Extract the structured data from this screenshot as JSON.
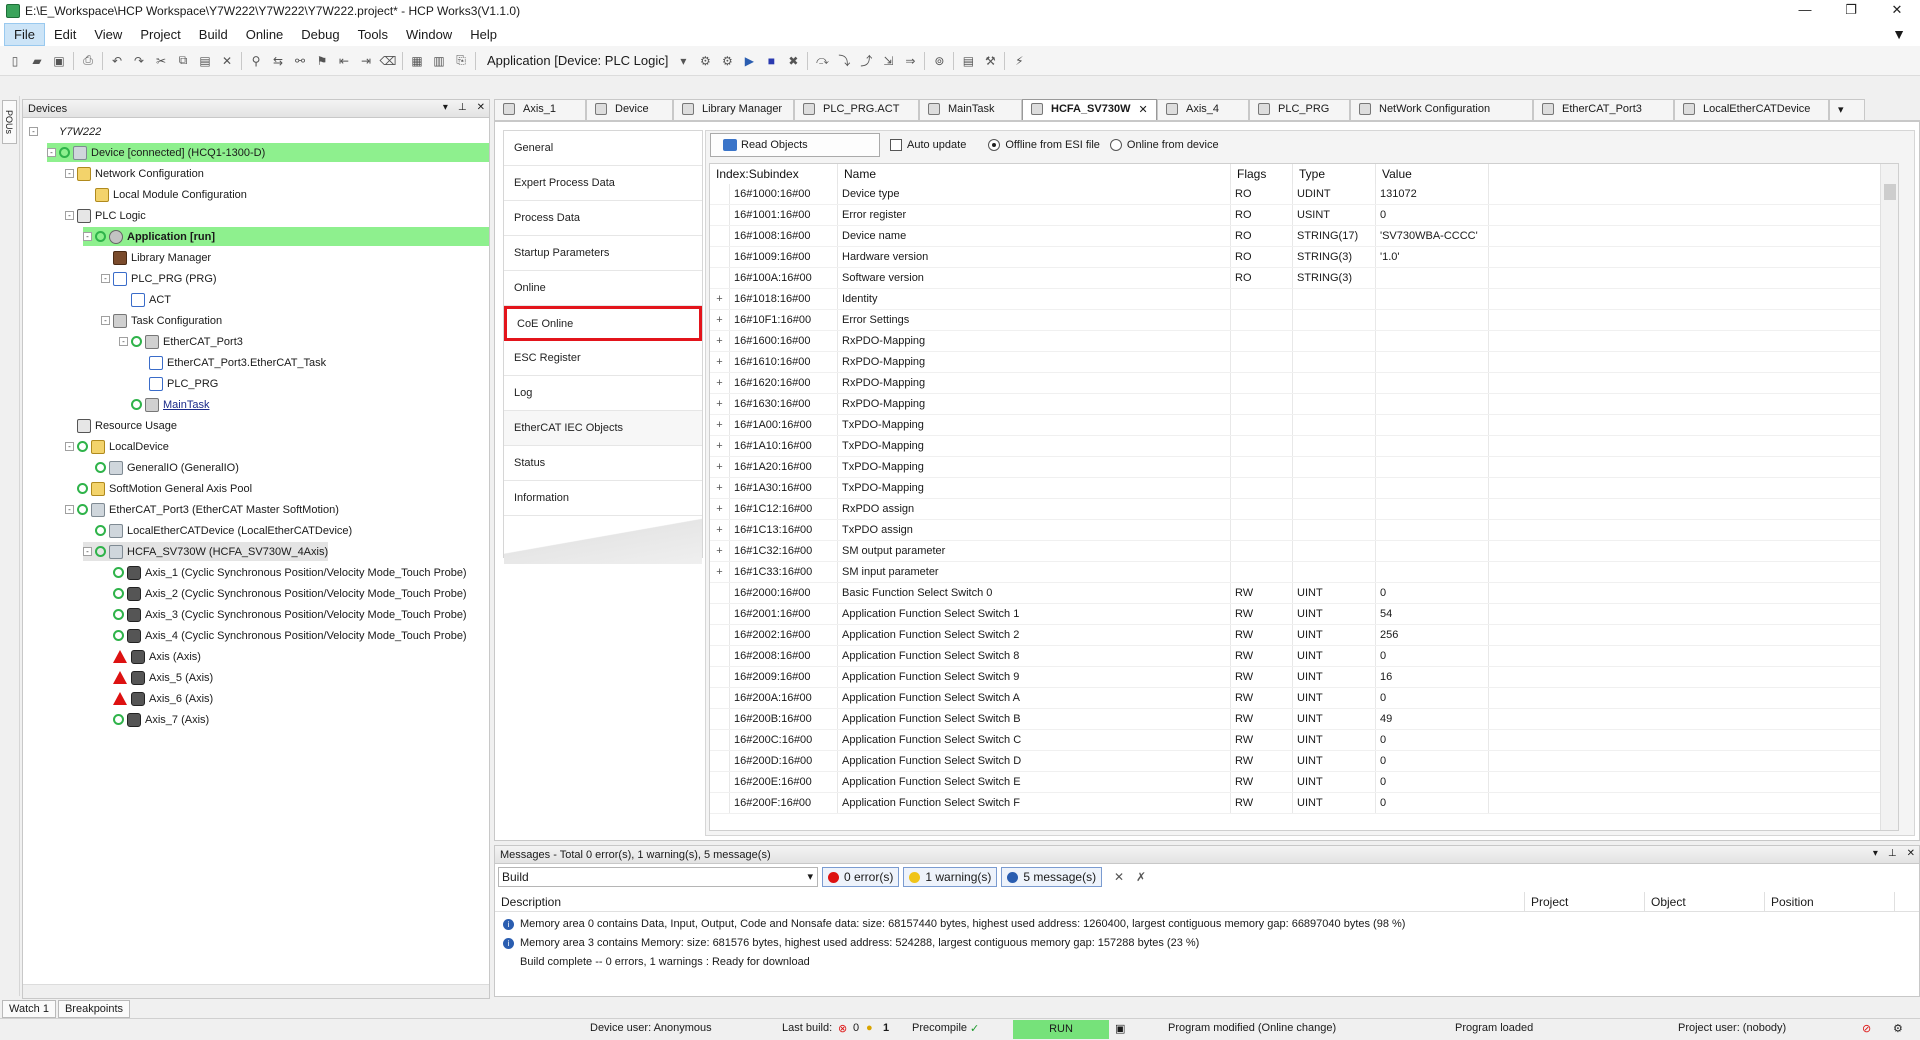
{
  "window": {
    "title": "E:\\E_Workspace\\HCP Workspace\\Y7W222\\Y7W222\\Y7W222.project* - HCP Works3(V1.1.0)"
  },
  "menu": [
    "File",
    "Edit",
    "View",
    "Project",
    "Build",
    "Online",
    "Debug",
    "Tools",
    "Window",
    "Help"
  ],
  "toolbar": {
    "application_selector": "Application [Device: PLC Logic]"
  },
  "left_strip": {
    "pous_tab": "POUs"
  },
  "devices": {
    "title": "Devices",
    "tree": [
      {
        "label": "Y7W222",
        "indent": 0,
        "exp": "-",
        "icon": "project",
        "italic": true
      },
      {
        "label": "Device [connected] (HCQ1-1300-D)",
        "indent": 1,
        "exp": "-",
        "icon": "dev",
        "green": true,
        "hl": true
      },
      {
        "label": "Network Configuration",
        "indent": 2,
        "exp": "-",
        "icon": "net"
      },
      {
        "label": "Local Module Configuration",
        "indent": 3,
        "exp": "",
        "icon": "net"
      },
      {
        "label": "PLC Logic",
        "indent": 2,
        "exp": "-",
        "icon": "plc"
      },
      {
        "label": "Application [run]",
        "indent": 3,
        "exp": "-",
        "icon": "app",
        "green": true,
        "hl": true,
        "bold": true
      },
      {
        "label": "Library Manager",
        "indent": 4,
        "exp": "",
        "icon": "lib"
      },
      {
        "label": "PLC_PRG (PRG)",
        "indent": 4,
        "exp": "-",
        "icon": "prg"
      },
      {
        "label": "ACT",
        "indent": 5,
        "exp": "",
        "icon": "prg"
      },
      {
        "label": "Task Configuration",
        "indent": 4,
        "exp": "-",
        "icon": "task"
      },
      {
        "label": "EtherCAT_Port3",
        "indent": 5,
        "exp": "-",
        "icon": "task",
        "green": true
      },
      {
        "label": "EtherCAT_Port3.EtherCAT_Task",
        "indent": 6,
        "exp": "",
        "icon": "prg"
      },
      {
        "label": "PLC_PRG",
        "indent": 6,
        "exp": "",
        "icon": "prg"
      },
      {
        "label": "MainTask",
        "indent": 5,
        "exp": "",
        "icon": "task",
        "green": true,
        "underline": true
      },
      {
        "label": "Resource Usage",
        "indent": 2,
        "exp": "",
        "icon": "plc"
      },
      {
        "label": "LocalDevice",
        "indent": 2,
        "exp": "-",
        "icon": "net",
        "green": true
      },
      {
        "label": "GeneralIO (GeneralIO)",
        "indent": 3,
        "exp": "",
        "icon": "dev",
        "green": true
      },
      {
        "label": "SoftMotion General Axis Pool",
        "indent": 2,
        "exp": "",
        "icon": "net",
        "green": true
      },
      {
        "label": "EtherCAT_Port3 (EtherCAT Master SoftMotion)",
        "indent": 2,
        "exp": "-",
        "icon": "dev",
        "green": true
      },
      {
        "label": "LocalEtherCATDevice (LocalEtherCATDevice)",
        "indent": 3,
        "exp": "",
        "icon": "dev",
        "green": true
      },
      {
        "label": "HCFA_SV730W (HCFA_SV730W_4Axis)",
        "indent": 3,
        "exp": "-",
        "icon": "dev",
        "green": true,
        "sel": true
      },
      {
        "label": "Axis_1 (Cyclic Synchronous Position/Velocity Mode_Touch Probe)",
        "indent": 4,
        "exp": "",
        "icon": "axis",
        "green": true
      },
      {
        "label": "Axis_2 (Cyclic Synchronous Position/Velocity Mode_Touch Probe)",
        "indent": 4,
        "exp": "",
        "icon": "axis",
        "green": true
      },
      {
        "label": "Axis_3 (Cyclic Synchronous Position/Velocity Mode_Touch Probe)",
        "indent": 4,
        "exp": "",
        "icon": "axis",
        "green": true
      },
      {
        "label": "Axis_4 (Cyclic Synchronous Position/Velocity Mode_Touch Probe)",
        "indent": 4,
        "exp": "",
        "icon": "axis",
        "green": true
      },
      {
        "label": "Axis (Axis)",
        "indent": 4,
        "exp": "",
        "icon": "axis",
        "warn": true
      },
      {
        "label": "Axis_5 (Axis)",
        "indent": 4,
        "exp": "",
        "icon": "axis",
        "warn": true
      },
      {
        "label": "Axis_6 (Axis)",
        "indent": 4,
        "exp": "",
        "icon": "axis",
        "warn": true
      },
      {
        "label": "Axis_7 (Axis)",
        "indent": 4,
        "exp": "",
        "icon": "axis",
        "green": true
      }
    ]
  },
  "bottom_tabs": [
    "Watch 1",
    "Breakpoints"
  ],
  "editor_tabs": [
    {
      "label": "Axis_1",
      "w": 92
    },
    {
      "label": "Device",
      "w": 87
    },
    {
      "label": "Library Manager",
      "w": 121
    },
    {
      "label": "PLC_PRG.ACT",
      "w": 125
    },
    {
      "label": "MainTask",
      "w": 103
    },
    {
      "label": "HCFA_SV730W",
      "w": 135,
      "active": true
    },
    {
      "label": "Axis_4",
      "w": 92
    },
    {
      "label": "PLC_PRG",
      "w": 101
    },
    {
      "label": "NetWork Configuration",
      "w": 183
    },
    {
      "label": "EtherCAT_Port3",
      "w": 141
    },
    {
      "label": "LocalEtherCATDevice",
      "w": 155
    }
  ],
  "side_nav": [
    {
      "label": "General"
    },
    {
      "label": "Expert Process Data"
    },
    {
      "label": "Process Data"
    },
    {
      "label": "Startup Parameters"
    },
    {
      "label": "Online"
    },
    {
      "label": "CoE Online",
      "selected": true
    },
    {
      "label": "ESC Register"
    },
    {
      "label": "Log"
    },
    {
      "label": "EtherCAT IEC Objects",
      "hover": true
    },
    {
      "label": "Status"
    },
    {
      "label": "Information"
    }
  ],
  "coe": {
    "read_button": "Read Objects",
    "auto_update": "Auto update",
    "offline_esi": "Offline from ESI file",
    "online_device": "Online from device",
    "columns": [
      "Index:Subindex",
      "Name",
      "Flags",
      "Type",
      "Value"
    ],
    "rows": [
      {
        "exp": "",
        "idx": "16#1000:16#00",
        "name": "Device type",
        "flags": "RO",
        "type": "UDINT",
        "value": "131072"
      },
      {
        "exp": "",
        "idx": "16#1001:16#00",
        "name": "Error register",
        "flags": "RO",
        "type": "USINT",
        "value": "0"
      },
      {
        "exp": "",
        "idx": "16#1008:16#00",
        "name": "Device name",
        "flags": "RO",
        "type": "STRING(17)",
        "value": "'SV730WBA-CCCC'"
      },
      {
        "exp": "",
        "idx": "16#1009:16#00",
        "name": "Hardware version",
        "flags": "RO",
        "type": "STRING(3)",
        "value": "'1.0'"
      },
      {
        "exp": "",
        "idx": "16#100A:16#00",
        "name": "Software version",
        "flags": "RO",
        "type": "STRING(3)",
        "value": ""
      },
      {
        "exp": "+",
        "idx": "16#1018:16#00",
        "name": "Identity",
        "flags": "",
        "type": "",
        "value": ""
      },
      {
        "exp": "+",
        "idx": "16#10F1:16#00",
        "name": "Error Settings",
        "flags": "",
        "type": "",
        "value": ""
      },
      {
        "exp": "+",
        "idx": "16#1600:16#00",
        "name": "RxPDO-Mapping",
        "flags": "",
        "type": "",
        "value": ""
      },
      {
        "exp": "+",
        "idx": "16#1610:16#00",
        "name": "RxPDO-Mapping",
        "flags": "",
        "type": "",
        "value": ""
      },
      {
        "exp": "+",
        "idx": "16#1620:16#00",
        "name": "RxPDO-Mapping",
        "flags": "",
        "type": "",
        "value": ""
      },
      {
        "exp": "+",
        "idx": "16#1630:16#00",
        "name": "RxPDO-Mapping",
        "flags": "",
        "type": "",
        "value": ""
      },
      {
        "exp": "+",
        "idx": "16#1A00:16#00",
        "name": "TxPDO-Mapping",
        "flags": "",
        "type": "",
        "value": ""
      },
      {
        "exp": "+",
        "idx": "16#1A10:16#00",
        "name": "TxPDO-Mapping",
        "flags": "",
        "type": "",
        "value": ""
      },
      {
        "exp": "+",
        "idx": "16#1A20:16#00",
        "name": "TxPDO-Mapping",
        "flags": "",
        "type": "",
        "value": ""
      },
      {
        "exp": "+",
        "idx": "16#1A30:16#00",
        "name": "TxPDO-Mapping",
        "flags": "",
        "type": "",
        "value": ""
      },
      {
        "exp": "+",
        "idx": "16#1C12:16#00",
        "name": "RxPDO assign",
        "flags": "",
        "type": "",
        "value": ""
      },
      {
        "exp": "+",
        "idx": "16#1C13:16#00",
        "name": "TxPDO assign",
        "flags": "",
        "type": "",
        "value": ""
      },
      {
        "exp": "+",
        "idx": "16#1C32:16#00",
        "name": "SM output parameter",
        "flags": "",
        "type": "",
        "value": ""
      },
      {
        "exp": "+",
        "idx": "16#1C33:16#00",
        "name": "SM input parameter",
        "flags": "",
        "type": "",
        "value": ""
      },
      {
        "exp": "",
        "idx": "16#2000:16#00",
        "name": "Basic Function Select Switch 0",
        "flags": "RW",
        "type": "UINT",
        "value": "0"
      },
      {
        "exp": "",
        "idx": "16#2001:16#00",
        "name": "Application Function Select Switch 1",
        "flags": "RW",
        "type": "UINT",
        "value": "54"
      },
      {
        "exp": "",
        "idx": "16#2002:16#00",
        "name": "Application Function Select Switch 2",
        "flags": "RW",
        "type": "UINT",
        "value": "256"
      },
      {
        "exp": "",
        "idx": "16#2008:16#00",
        "name": "Application Function Select Switch 8",
        "flags": "RW",
        "type": "UINT",
        "value": "0"
      },
      {
        "exp": "",
        "idx": "16#2009:16#00",
        "name": "Application Function Select Switch 9",
        "flags": "RW",
        "type": "UINT",
        "value": "16"
      },
      {
        "exp": "",
        "idx": "16#200A:16#00",
        "name": "Application Function Select Switch A",
        "flags": "RW",
        "type": "UINT",
        "value": "0"
      },
      {
        "exp": "",
        "idx": "16#200B:16#00",
        "name": "Application Function Select Switch B",
        "flags": "RW",
        "type": "UINT",
        "value": "49"
      },
      {
        "exp": "",
        "idx": "16#200C:16#00",
        "name": "Application Function Select Switch C",
        "flags": "RW",
        "type": "UINT",
        "value": "0"
      },
      {
        "exp": "",
        "idx": "16#200D:16#00",
        "name": "Application Function Select Switch D",
        "flags": "RW",
        "type": "UINT",
        "value": "0"
      },
      {
        "exp": "",
        "idx": "16#200E:16#00",
        "name": "Application Function Select Switch E",
        "flags": "RW",
        "type": "UINT",
        "value": "0"
      },
      {
        "exp": "",
        "idx": "16#200F:16#00",
        "name": "Application Function Select Switch F",
        "flags": "RW",
        "type": "UINT",
        "value": "0"
      }
    ]
  },
  "messages": {
    "title": "Messages - Total 0 error(s), 1 warning(s), 5 message(s)",
    "source": "Build",
    "errors": "0 error(s)",
    "warnings": "1 warning(s)",
    "infos": "5 message(s)",
    "columns": [
      "Description",
      "Project",
      "Object",
      "Position"
    ],
    "rows": [
      {
        "icon": "info",
        "text": "Memory area 0 contains  Data, Input, Output, Code and Nonsafe data: size: 68157440 bytes, highest used address: 1260400, largest contiguous memory gap: 66897040 bytes (98 %)"
      },
      {
        "icon": "info",
        "text": "Memory area 3 contains  Memory: size: 681576 bytes, highest used address: 524288, largest contiguous memory gap: 157288 bytes (23 %)"
      },
      {
        "icon": "",
        "text": "Build complete -- 0 errors, 1 warnings : Ready for download"
      }
    ]
  },
  "status": {
    "device_user": "Device user: Anonymous",
    "last_build": "Last build:",
    "last_build_errors": "0",
    "last_build_warnings": "1",
    "precompile": "Precompile",
    "run": "RUN",
    "program_modified": "Program modified (Online change)",
    "program_loaded": "Program loaded",
    "project_user": "Project user: (nobody)"
  },
  "colors": {
    "connected_highlight": "#8ef08e",
    "run_badge": "#76e27a",
    "selected_outline": "#e3141b",
    "info_icon": "#2a5db0"
  }
}
